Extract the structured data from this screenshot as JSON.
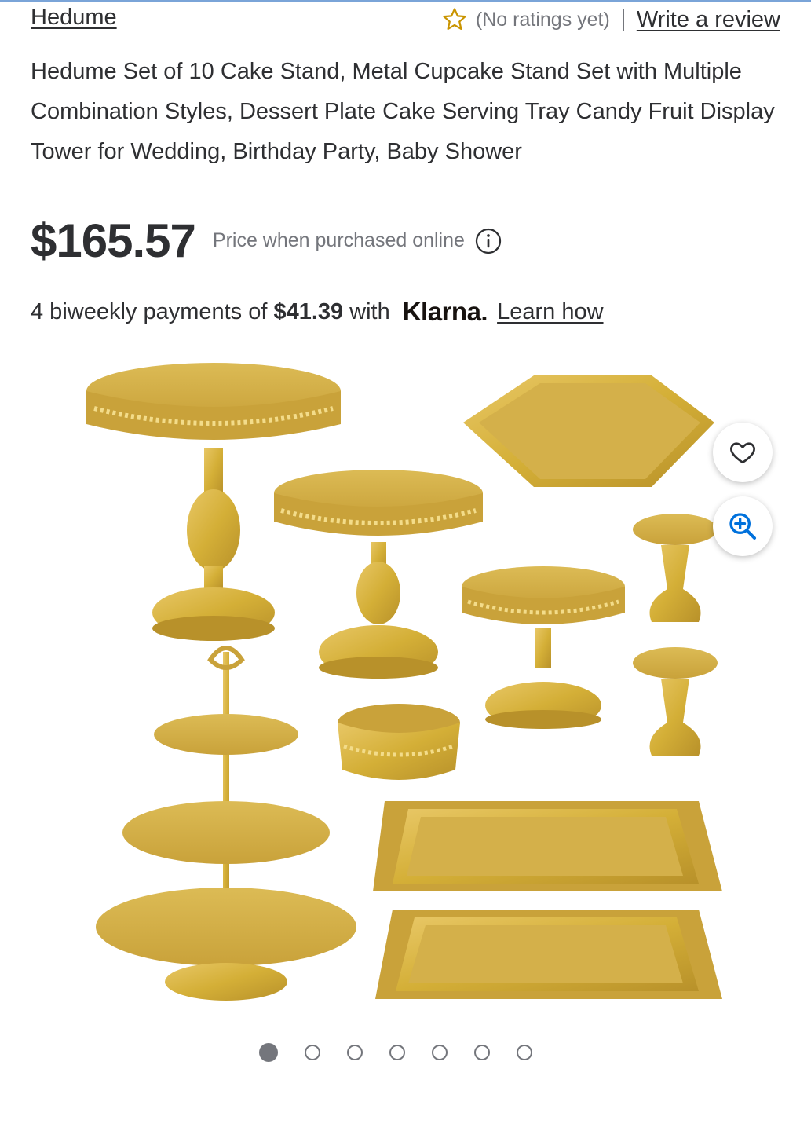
{
  "header": {
    "brand": "Hedume",
    "rating_text": "(No ratings yet)",
    "write_review": "Write a review"
  },
  "product": {
    "title": "Hedume Set of 10 Cake Stand, Metal Cupcake Stand Set with Multiple Combination Styles, Dessert Plate Cake Serving Tray Candy Fruit Display Tower for Wedding, Birthday Party, Baby Shower",
    "price": "$165.57",
    "price_note": "Price when purchased online"
  },
  "klarna": {
    "prefix": "4 biweekly payments of",
    "amount": "$41.39",
    "with": "with",
    "logo": "Klarna.",
    "learn_how": "Learn how"
  },
  "gallery": {
    "dot_count": 7,
    "active_index": 0
  },
  "icons": {
    "rating": "star-outline-icon",
    "info": "info-icon",
    "favorite": "heart-icon",
    "zoom": "zoom-in-icon"
  },
  "colors": {
    "text": "#2e2f32",
    "muted": "#74767c",
    "star": "#c99400",
    "zoom_blue": "#0071dc",
    "gold": "#d4af37"
  }
}
